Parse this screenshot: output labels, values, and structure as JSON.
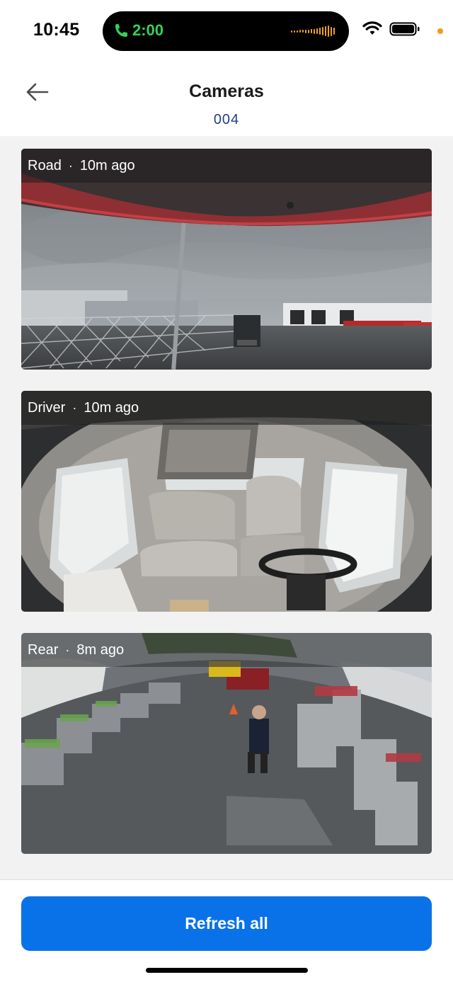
{
  "status_bar": {
    "time": "10:45",
    "call_duration": "2:00",
    "icons": [
      "phone-icon",
      "audio-wave-icon",
      "wifi-icon",
      "battery-icon",
      "privacy-dot-icon"
    ],
    "colors": {
      "call_green": "#34d15a",
      "wave_orange": "#f0a21e",
      "privacy_dot": "#f29a18"
    }
  },
  "header": {
    "back_icon": "arrow-left-icon",
    "title": "Cameras",
    "subtitle": "004"
  },
  "cameras": [
    {
      "name": "Road",
      "separator": "·",
      "age": "10m ago"
    },
    {
      "name": "Driver",
      "separator": "·",
      "age": "10m ago"
    },
    {
      "name": "Rear",
      "separator": "·",
      "age": "8m ago"
    }
  ],
  "footer": {
    "refresh_label": "Refresh all"
  },
  "colors": {
    "accent": "#0a72e8",
    "subtitle": "#1f3d8a",
    "content_bg": "#f2f2f2"
  }
}
